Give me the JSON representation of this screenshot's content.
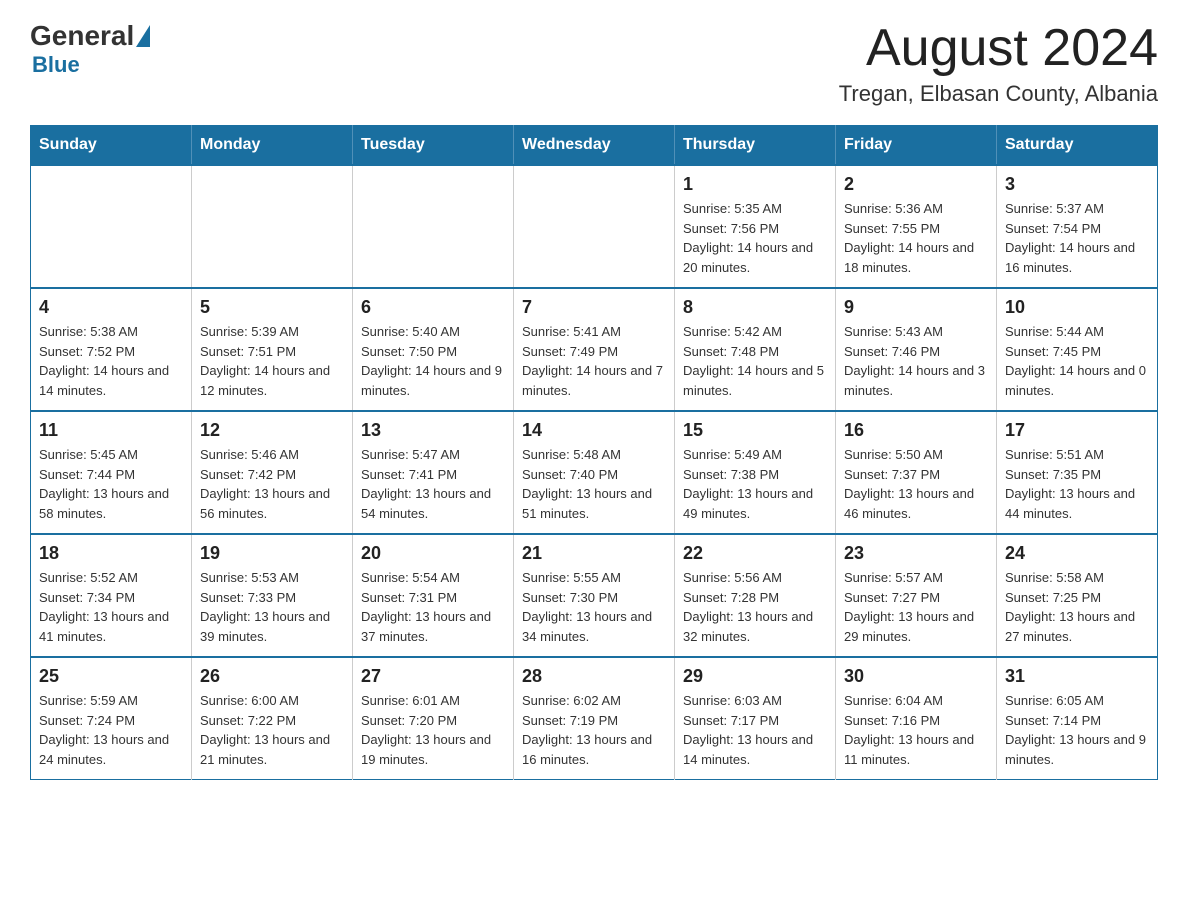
{
  "header": {
    "logo_general": "General",
    "logo_blue": "Blue",
    "title": "August 2024",
    "subtitle": "Tregan, Elbasan County, Albania"
  },
  "days_of_week": [
    "Sunday",
    "Monday",
    "Tuesday",
    "Wednesday",
    "Thursday",
    "Friday",
    "Saturday"
  ],
  "weeks": [
    [
      {
        "day": "",
        "info": ""
      },
      {
        "day": "",
        "info": ""
      },
      {
        "day": "",
        "info": ""
      },
      {
        "day": "",
        "info": ""
      },
      {
        "day": "1",
        "info": "Sunrise: 5:35 AM\nSunset: 7:56 PM\nDaylight: 14 hours and 20 minutes."
      },
      {
        "day": "2",
        "info": "Sunrise: 5:36 AM\nSunset: 7:55 PM\nDaylight: 14 hours and 18 minutes."
      },
      {
        "day": "3",
        "info": "Sunrise: 5:37 AM\nSunset: 7:54 PM\nDaylight: 14 hours and 16 minutes."
      }
    ],
    [
      {
        "day": "4",
        "info": "Sunrise: 5:38 AM\nSunset: 7:52 PM\nDaylight: 14 hours and 14 minutes."
      },
      {
        "day": "5",
        "info": "Sunrise: 5:39 AM\nSunset: 7:51 PM\nDaylight: 14 hours and 12 minutes."
      },
      {
        "day": "6",
        "info": "Sunrise: 5:40 AM\nSunset: 7:50 PM\nDaylight: 14 hours and 9 minutes."
      },
      {
        "day": "7",
        "info": "Sunrise: 5:41 AM\nSunset: 7:49 PM\nDaylight: 14 hours and 7 minutes."
      },
      {
        "day": "8",
        "info": "Sunrise: 5:42 AM\nSunset: 7:48 PM\nDaylight: 14 hours and 5 minutes."
      },
      {
        "day": "9",
        "info": "Sunrise: 5:43 AM\nSunset: 7:46 PM\nDaylight: 14 hours and 3 minutes."
      },
      {
        "day": "10",
        "info": "Sunrise: 5:44 AM\nSunset: 7:45 PM\nDaylight: 14 hours and 0 minutes."
      }
    ],
    [
      {
        "day": "11",
        "info": "Sunrise: 5:45 AM\nSunset: 7:44 PM\nDaylight: 13 hours and 58 minutes."
      },
      {
        "day": "12",
        "info": "Sunrise: 5:46 AM\nSunset: 7:42 PM\nDaylight: 13 hours and 56 minutes."
      },
      {
        "day": "13",
        "info": "Sunrise: 5:47 AM\nSunset: 7:41 PM\nDaylight: 13 hours and 54 minutes."
      },
      {
        "day": "14",
        "info": "Sunrise: 5:48 AM\nSunset: 7:40 PM\nDaylight: 13 hours and 51 minutes."
      },
      {
        "day": "15",
        "info": "Sunrise: 5:49 AM\nSunset: 7:38 PM\nDaylight: 13 hours and 49 minutes."
      },
      {
        "day": "16",
        "info": "Sunrise: 5:50 AM\nSunset: 7:37 PM\nDaylight: 13 hours and 46 minutes."
      },
      {
        "day": "17",
        "info": "Sunrise: 5:51 AM\nSunset: 7:35 PM\nDaylight: 13 hours and 44 minutes."
      }
    ],
    [
      {
        "day": "18",
        "info": "Sunrise: 5:52 AM\nSunset: 7:34 PM\nDaylight: 13 hours and 41 minutes."
      },
      {
        "day": "19",
        "info": "Sunrise: 5:53 AM\nSunset: 7:33 PM\nDaylight: 13 hours and 39 minutes."
      },
      {
        "day": "20",
        "info": "Sunrise: 5:54 AM\nSunset: 7:31 PM\nDaylight: 13 hours and 37 minutes."
      },
      {
        "day": "21",
        "info": "Sunrise: 5:55 AM\nSunset: 7:30 PM\nDaylight: 13 hours and 34 minutes."
      },
      {
        "day": "22",
        "info": "Sunrise: 5:56 AM\nSunset: 7:28 PM\nDaylight: 13 hours and 32 minutes."
      },
      {
        "day": "23",
        "info": "Sunrise: 5:57 AM\nSunset: 7:27 PM\nDaylight: 13 hours and 29 minutes."
      },
      {
        "day": "24",
        "info": "Sunrise: 5:58 AM\nSunset: 7:25 PM\nDaylight: 13 hours and 27 minutes."
      }
    ],
    [
      {
        "day": "25",
        "info": "Sunrise: 5:59 AM\nSunset: 7:24 PM\nDaylight: 13 hours and 24 minutes."
      },
      {
        "day": "26",
        "info": "Sunrise: 6:00 AM\nSunset: 7:22 PM\nDaylight: 13 hours and 21 minutes."
      },
      {
        "day": "27",
        "info": "Sunrise: 6:01 AM\nSunset: 7:20 PM\nDaylight: 13 hours and 19 minutes."
      },
      {
        "day": "28",
        "info": "Sunrise: 6:02 AM\nSunset: 7:19 PM\nDaylight: 13 hours and 16 minutes."
      },
      {
        "day": "29",
        "info": "Sunrise: 6:03 AM\nSunset: 7:17 PM\nDaylight: 13 hours and 14 minutes."
      },
      {
        "day": "30",
        "info": "Sunrise: 6:04 AM\nSunset: 7:16 PM\nDaylight: 13 hours and 11 minutes."
      },
      {
        "day": "31",
        "info": "Sunrise: 6:05 AM\nSunset: 7:14 PM\nDaylight: 13 hours and 9 minutes."
      }
    ]
  ]
}
